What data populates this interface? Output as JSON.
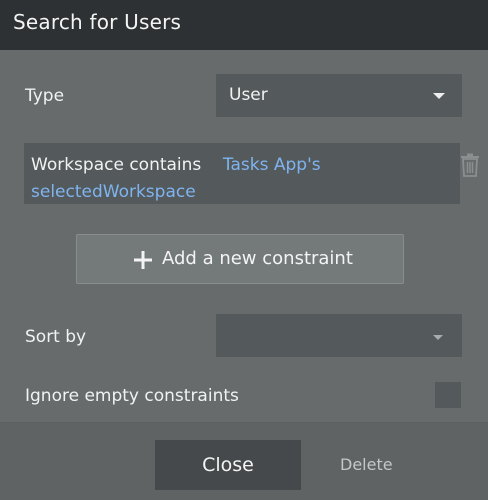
{
  "dialog": {
    "title": "Search for Users"
  },
  "type_field": {
    "label": "Type",
    "value": "User"
  },
  "constraint": {
    "prefix": "Workspace contains",
    "dynamic_part1": "Tasks App's",
    "dynamic_part2": "selectedWorkspace"
  },
  "add_constraint": {
    "label": "Add a new constraint"
  },
  "sort_field": {
    "label": "Sort by",
    "value": ""
  },
  "ignore_empty": {
    "label": "Ignore empty constraints",
    "checked": false
  },
  "footer": {
    "close_label": "Close",
    "delete_label": "Delete"
  },
  "icons": {
    "trash": "trash-icon",
    "plus": "plus-icon",
    "caret": "chevron-down-icon"
  },
  "colors": {
    "dynamic_text": "#7fb4ef",
    "panel_bg": "#676b6c",
    "titlebar_bg": "#2e3133"
  }
}
